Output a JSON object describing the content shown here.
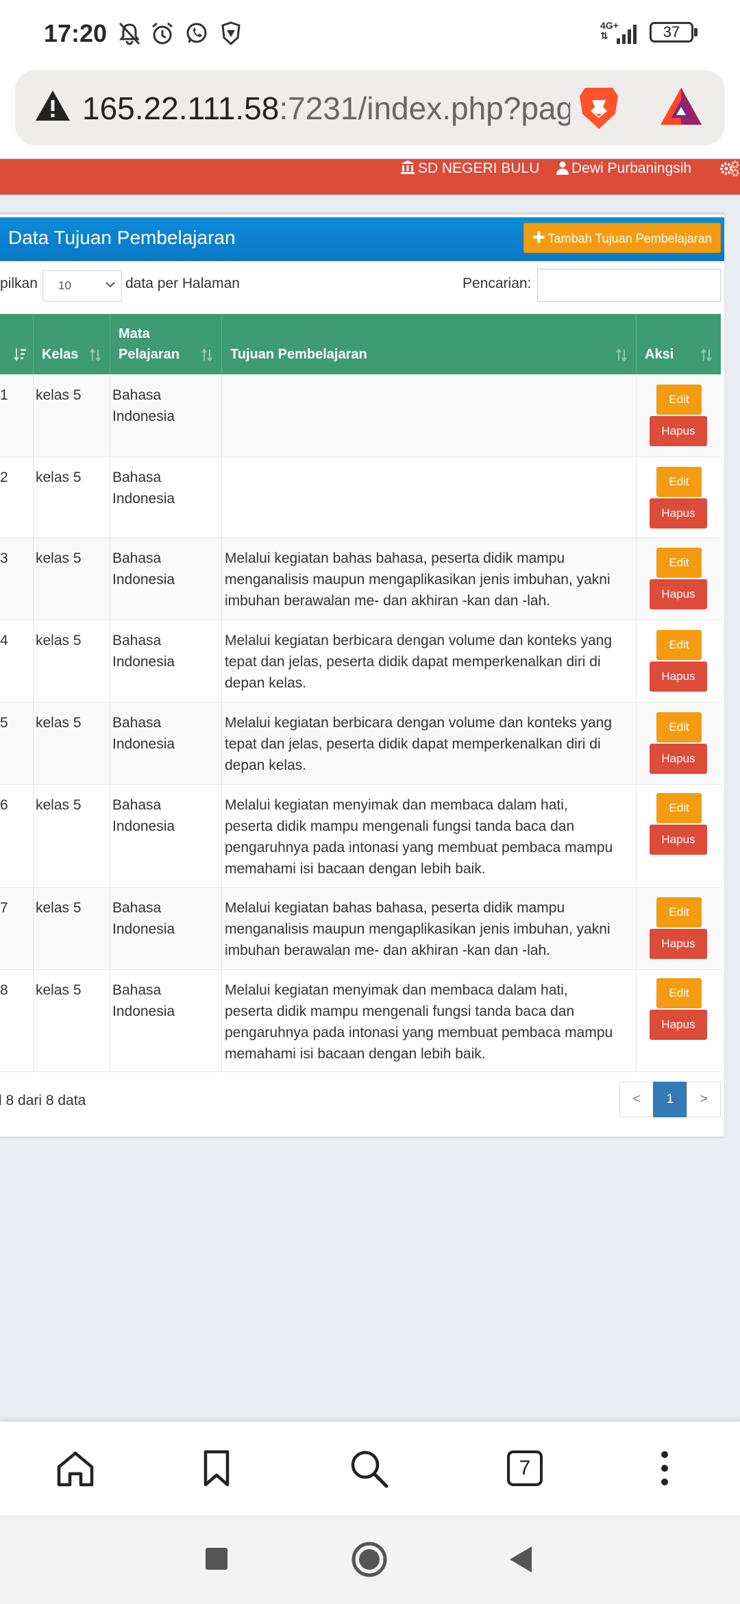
{
  "status_bar": {
    "time": "17:20",
    "network": "4G+",
    "battery": "37"
  },
  "browser": {
    "url_host": "165.22.111.58",
    "url_rest": ":7231/index.php?pag",
    "tab_count": "7"
  },
  "topnav": {
    "school": "SD NEGERI BULU",
    "user": "Dewi Purbaningsih"
  },
  "panel": {
    "title": "Data Tujuan Pembelajaran",
    "add_button": "Tambah Tujuan Pembelajaran",
    "length_prefix": "pilkan",
    "length_value": "10",
    "length_suffix": "data per Halaman",
    "search_label": "Pencarian:",
    "search_value": ""
  },
  "table": {
    "headers": {
      "no": "",
      "kelas": "Kelas",
      "mapel_line1": "Mata",
      "mapel_line2": "Pelajaran",
      "tujuan": "Tujuan Pembelajaran",
      "aksi": "Aksi"
    },
    "edit_label": "Edit",
    "delete_label": "Hapus",
    "rows": [
      {
        "no": "1",
        "kelas": "kelas 5",
        "mapel": "Bahasa Indonesia",
        "tujuan": ""
      },
      {
        "no": "2",
        "kelas": "kelas 5",
        "mapel": "Bahasa Indonesia",
        "tujuan": ""
      },
      {
        "no": "3",
        "kelas": "kelas 5",
        "mapel": "Bahasa Indonesia",
        "tujuan": "Melalui kegiatan bahas bahasa, peserta didik mampu menganalisis maupun mengaplikasikan jenis imbuhan, yakni imbuhan berawalan me- dan akhiran -kan dan -lah."
      },
      {
        "no": "4",
        "kelas": "kelas 5",
        "mapel": "Bahasa Indonesia",
        "tujuan": "Melalui kegiatan berbicara dengan volume dan konteks yang tepat dan jelas, peserta didik dapat memperkenalkan diri di depan kelas."
      },
      {
        "no": "5",
        "kelas": "kelas 5",
        "mapel": "Bahasa Indonesia",
        "tujuan": "Melalui kegiatan berbicara dengan volume dan konteks yang tepat dan jelas, peserta didik dapat memperkenalkan diri di depan kelas."
      },
      {
        "no": "6",
        "kelas": "kelas 5",
        "mapel": "Bahasa Indonesia",
        "tujuan": "Melalui kegiatan menyimak dan membaca dalam hati, peserta didik mampu mengenali fungsi tanda baca dan pengaruhnya pada intonasi yang membuat pembaca mampu memahami isi bacaan dengan lebih baik."
      },
      {
        "no": "7",
        "kelas": "kelas 5",
        "mapel": "Bahasa Indonesia",
        "tujuan": "Melalui kegiatan bahas bahasa, peserta didik mampu menganalisis maupun mengaplikasikan jenis imbuhan, yakni imbuhan berawalan me- dan akhiran -kan dan -lah."
      },
      {
        "no": "8",
        "kelas": "kelas 5",
        "mapel": "Bahasa Indonesia",
        "tujuan": "Melalui kegiatan menyimak dan membaca dalam hati, peserta didik mampu mengenali fungsi tanda baca dan pengaruhnya pada intonasi yang membuat pembaca mampu memahami isi bacaan dengan lebih baik."
      }
    ]
  },
  "footer": {
    "info": "l 8 dari 8 data",
    "prev": "<",
    "page": "1",
    "next": ">"
  },
  "colors": {
    "header_red": "#dd4b39",
    "panel_blue": "#0a78c4",
    "table_head_green": "#3e9b72",
    "edit_orange": "#f39c12",
    "delete_red": "#dd4b39",
    "page_active": "#337ab7"
  }
}
